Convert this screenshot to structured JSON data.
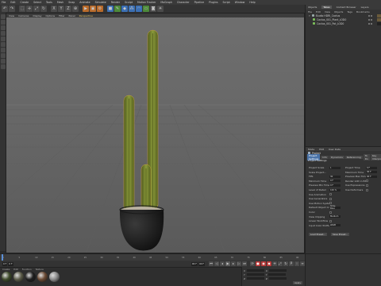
{
  "menubar": {
    "items": [
      "File",
      "Edit",
      "Create",
      "Select",
      "Tools",
      "Mesh",
      "Snap",
      "Animate",
      "Simulate",
      "Render",
      "Sculpt",
      "Motion Tracker",
      "MoGraph",
      "Character",
      "Pipeline",
      "Plugins",
      "Script",
      "Window",
      "Help"
    ]
  },
  "viewport": {
    "menu": [
      "View",
      "Cameras",
      "Display",
      "Options",
      "Filter",
      "Panel"
    ],
    "camera_label": "Perspective"
  },
  "object_manager": {
    "tabs": [
      "Objects",
      "Takes",
      "Content Browser",
      "Layers"
    ],
    "active_tab": "Takes",
    "menu": [
      "File",
      "Edit",
      "View",
      "Objects",
      "Tags",
      "Bookmarks"
    ],
    "objects": [
      {
        "name": "Studio HDRI_Cactus",
        "level": 0
      },
      {
        "name": "Cactus_001_Plant_LOD0",
        "level": 1
      },
      {
        "name": "Cactus_001_Pot_LOD0",
        "level": 1
      }
    ]
  },
  "attributes": {
    "tabs": [
      "Mode",
      "Edit",
      "User Data"
    ],
    "title": "Project",
    "subtabs": [
      "Project Settings",
      "Info",
      "Dynamics",
      "Referencing",
      "To Do",
      "Key Interpolation"
    ],
    "section": "Project Settings",
    "fields_left": [
      {
        "label": "Project Scale",
        "value": "1"
      },
      {
        "label": "Scale Project...",
        "value": ""
      },
      {
        "label": "FPS",
        "value": "30"
      },
      {
        "label": "Minimum Time",
        "value": "0 F"
      },
      {
        "label": "Preview Min Time",
        "value": "0 F"
      },
      {
        "label": "Level of Detail",
        "value": "100 %"
      },
      {
        "label": "Use Animation",
        "value": ""
      },
      {
        "label": "Use Generators",
        "value": ""
      },
      {
        "label": "Use Motion System",
        "value": ""
      },
      {
        "label": "Default Object Color",
        "value": "Gray-Blue"
      },
      {
        "label": "Color",
        "value": ""
      },
      {
        "label": "View Clipping",
        "value": "Medium"
      },
      {
        "label": "Linear Workflow",
        "value": ""
      },
      {
        "label": "Input Color Profile",
        "value": "sRGB"
      }
    ],
    "fields_right": [
      {
        "label": "Project Time",
        "value": "0 F"
      },
      {
        "label": "Maximum Time",
        "value": "90 F"
      },
      {
        "label": "Preview Max Time",
        "value": "90 F"
      },
      {
        "label": "Render LOD in Editor",
        "value": ""
      },
      {
        "label": "Use Expressions",
        "value": ""
      },
      {
        "label": "Use Deformers",
        "value": ""
      }
    ],
    "buttons": [
      "Load Preset...",
      "Save Preset..."
    ]
  },
  "timeline": {
    "ticks": [
      "0",
      "5",
      "10",
      "15",
      "20",
      "25",
      "30",
      "35",
      "40",
      "45",
      "50",
      "55",
      "60",
      "65",
      "70",
      "75",
      "80",
      "85",
      "90"
    ],
    "start_field": "0 F",
    "current_field": "0 F",
    "end_field": "90 F",
    "max_field": "90 F"
  },
  "materials": {
    "menu": [
      "Create",
      "Edit",
      "Function",
      "Texture"
    ],
    "swatches": [
      "#3d4a2a",
      "#5a5a48",
      "#1e1e1e",
      "#6a4a34",
      "#8a8a8a"
    ]
  },
  "coordinates": {
    "labels": [
      "X",
      "Y",
      "Z"
    ],
    "apply": "Apply"
  },
  "colors": {
    "accent": "#4a73a8",
    "viewport_bg": "#6a6a6a",
    "cactus": "#7a8a30",
    "pot": "#141414"
  }
}
